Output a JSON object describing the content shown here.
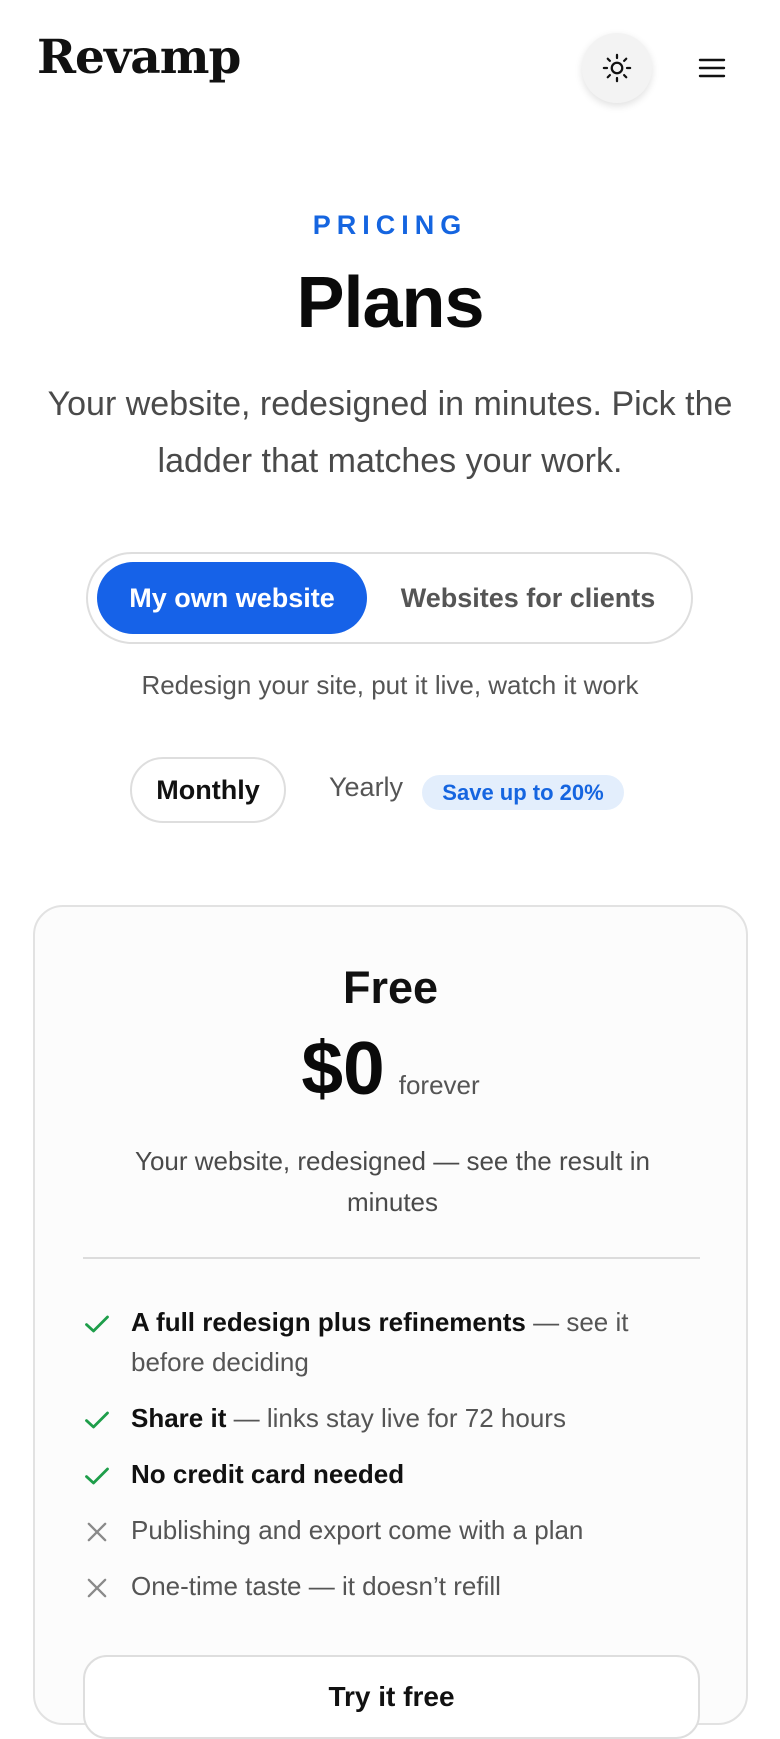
{
  "header": {
    "logo": "Revamp",
    "theme_icon": "sun-icon",
    "menu_icon": "hamburger-menu-icon"
  },
  "hero": {
    "eyebrow": "PRICING",
    "title": "Plans",
    "subtitle": "Your website, redesigned in minutes. Pick the ladder that matches your work."
  },
  "audience_toggle": {
    "options": [
      {
        "label": "My own website",
        "selected": true
      },
      {
        "label": "Websites for clients",
        "selected": false
      }
    ],
    "caption": "Redesign your site, put it live, watch it work"
  },
  "billing_toggle": {
    "monthly_label": "Monthly",
    "yearly_label": "Yearly",
    "save_badge": "Save up to 20%",
    "selected": "Monthly"
  },
  "plan_card": {
    "name": "Free",
    "price": "$0",
    "period": "forever",
    "description": "Your website, redesigned — see the result in minutes",
    "features": [
      {
        "included": true,
        "strong": "A full redesign plus refinements",
        "rest": " — see it before deciding"
      },
      {
        "included": true,
        "strong": "Share it",
        "rest": " — links stay live for 72 hours"
      },
      {
        "included": true,
        "strong": "No credit card needed",
        "rest": ""
      },
      {
        "included": false,
        "strong": "",
        "rest": "Publishing and export come with a plan"
      },
      {
        "included": false,
        "strong": "",
        "rest": "One-time taste — it doesn’t refill"
      }
    ],
    "cta_label": "Try it free"
  },
  "colors": {
    "accent": "#1662e8",
    "check": "#1e9e4a",
    "cross": "#8a8a8a",
    "badge_bg": "#e3eefc"
  }
}
